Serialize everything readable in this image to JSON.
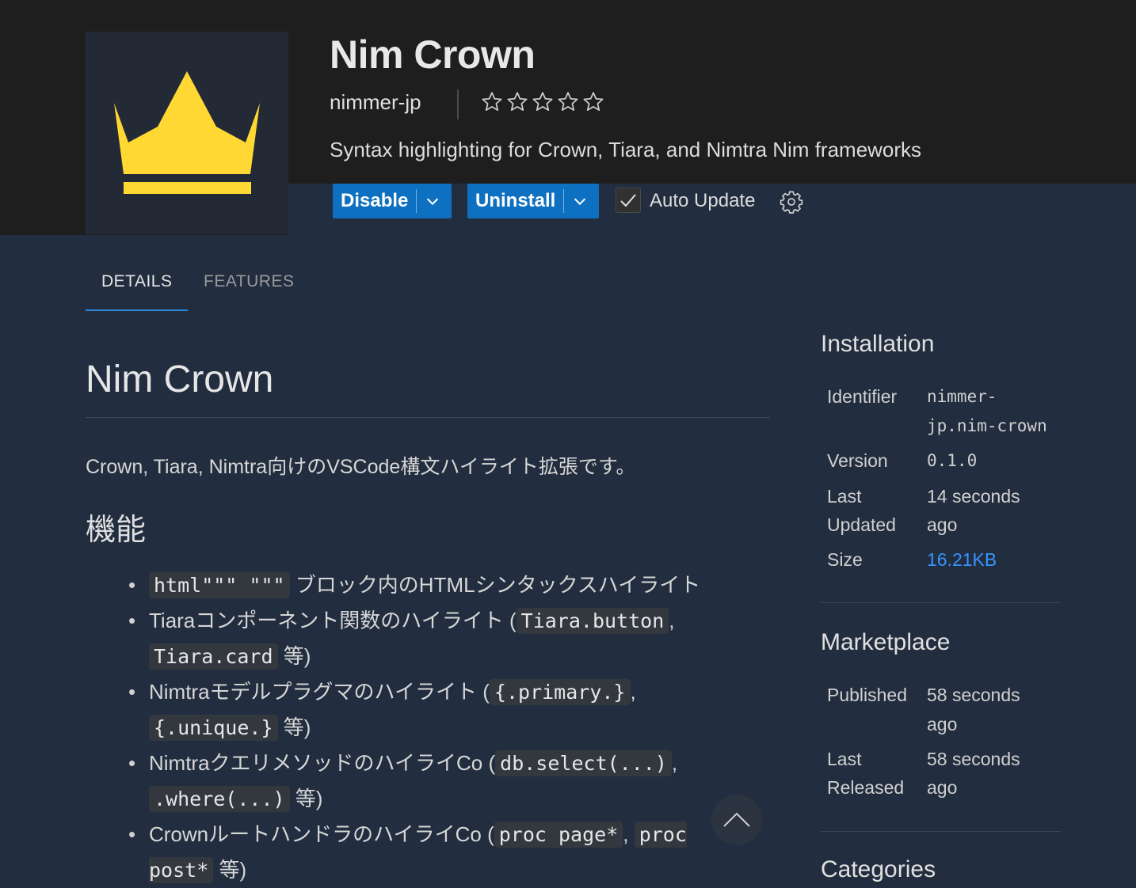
{
  "extension": {
    "name": "Nim Crown",
    "publisher": "nimmer-jp",
    "rating_stars": 0,
    "rating_max": 5,
    "description": "Syntax highlighting for Crown, Tiara, and Nimtra Nim frameworks",
    "logo_colors": {
      "background": "#232a36",
      "crown": "#ffd833"
    }
  },
  "actions": {
    "disable_label": "Disable",
    "uninstall_label": "Uninstall",
    "auto_update_label": "Auto Update",
    "auto_update_checked": true,
    "accent": "#0e70c0"
  },
  "tabs": [
    {
      "label": "DETAILS",
      "active": true
    },
    {
      "label": "FEATURES",
      "active": false
    }
  ],
  "readme": {
    "title": "Nim Crown",
    "intro": "Crown, Tiara, Nimtra向けのVSCode構文ハイライト拡張です。",
    "features_heading": "機能",
    "features": [
      {
        "pre": "",
        "code1": "html\"\"\" \"\"\"",
        "mid": " ブロック内のHTMLシンタックスハイライト",
        "code2": "",
        "post": ""
      },
      {
        "pre": "Tiaraコンポーネント関数のハイライト (",
        "code1": "Tiara.button",
        "mid": ", ",
        "code2": "Tiara.card",
        "post": " 等)"
      },
      {
        "pre": "Nimtraモデルプラグマのハイライト (",
        "code1": "{.primary.}",
        "mid": ", ",
        "code2": "{.unique.}",
        "post": " 等)"
      },
      {
        "pre": "NimtraクエリメソッドのハイライCo (",
        "code1": "db.select(...)",
        "mid": ", ",
        "code2": ".where(...)",
        "post": " 等)"
      },
      {
        "pre": "CrownルートハンドラのハイライCo (",
        "code1": "proc page*",
        "mid": ", ",
        "code2": "proc post*",
        "post": " 等)"
      }
    ]
  },
  "sidebar": {
    "installation": {
      "heading": "Installation",
      "identifier_label": "Identifier",
      "identifier_value_1": "nimmer-",
      "identifier_value_2": "jp.nim-crown",
      "version_label": "Version",
      "version_value": "0.1.0",
      "last_updated_label_1": "Last",
      "last_updated_label_2": "Updated",
      "last_updated_value_1": "14 seconds",
      "last_updated_value_2": "ago",
      "size_label": "Size",
      "size_value": "16.21KB"
    },
    "marketplace": {
      "heading": "Marketplace",
      "published_label": "Published",
      "published_value_1": "58 seconds",
      "published_value_2": "ago",
      "last_released_label_1": "Last",
      "last_released_label_2": "Released",
      "last_released_value_1": "58 seconds",
      "last_released_value_2": "ago"
    },
    "categories": {
      "heading": "Categories"
    }
  }
}
